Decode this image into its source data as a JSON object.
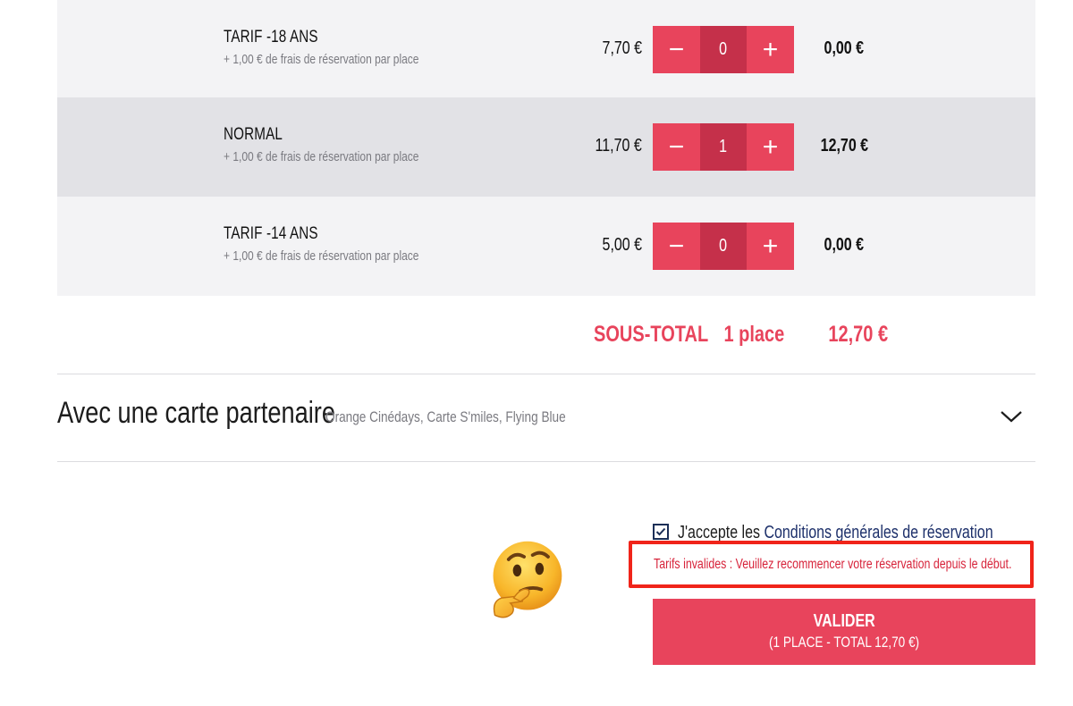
{
  "rates": [
    {
      "name": "TARIF -18 ANS",
      "fee": "+ 1,00 € de frais de réservation par place",
      "price": "7,70 €",
      "quantity": "0",
      "total": "0,00 €",
      "minus": "−",
      "plus": "+"
    },
    {
      "name": "NORMAL",
      "fee": "+ 1,00 € de frais de réservation par place",
      "price": "11,70 €",
      "quantity": "1",
      "total": "12,70 €",
      "minus": "−",
      "plus": "+"
    },
    {
      "name": "TARIF -14 ANS",
      "fee": "+ 1,00 € de frais de réservation par place",
      "price": "5,00 €",
      "quantity": "0",
      "total": "0,00 €",
      "minus": "−",
      "plus": "+"
    }
  ],
  "subtotal": {
    "label": "SOUS-TOTAL",
    "places": "1 place",
    "amount": "12,70 €"
  },
  "partner": {
    "title": "Avec une carte partenaire",
    "subtitle": "Orange Cinédays, Carte S'miles, Flying Blue",
    "icon": "chevron-down-icon"
  },
  "terms": {
    "checked": true,
    "prefix": "J'accepte les",
    "link": "Conditions générales de réservation"
  },
  "error": {
    "message": "Tarifs invalides : Veuillez recommencer votre réservation depuis le début."
  },
  "submit": {
    "label": "VALIDER",
    "sub": "(1 PLACE - TOTAL 12,70 €)"
  },
  "decoration": {
    "icon": "thinking-face-emoji"
  },
  "colors": {
    "accent": "#e8445c",
    "accent_dark": "#c5304a",
    "error_border": "#f0241a",
    "link": "#1c2f6a",
    "row_alt": "#e2e2e6",
    "row_plain": "#f3f3f5"
  }
}
